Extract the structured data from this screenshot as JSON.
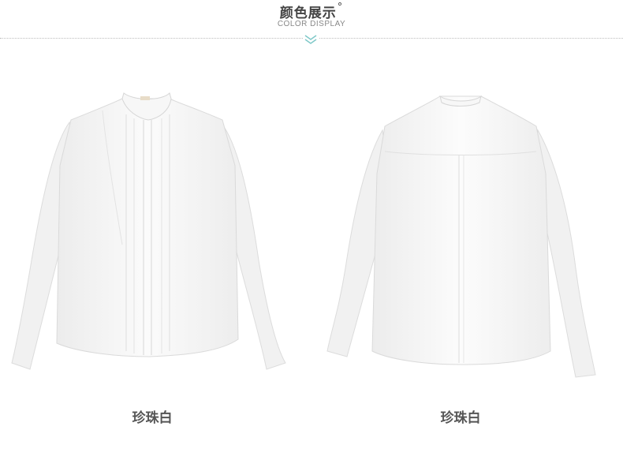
{
  "header": {
    "title": "颜色展示",
    "degree_mark": "°",
    "subtitle": "COLOR DISPLAY",
    "divider_icon": "chevron-down-double-icon",
    "accent_color": "#7ec8c8"
  },
  "products": [
    {
      "view": "front",
      "color_name": "珍珠白"
    },
    {
      "view": "back",
      "color_name": "珍珠白"
    }
  ]
}
